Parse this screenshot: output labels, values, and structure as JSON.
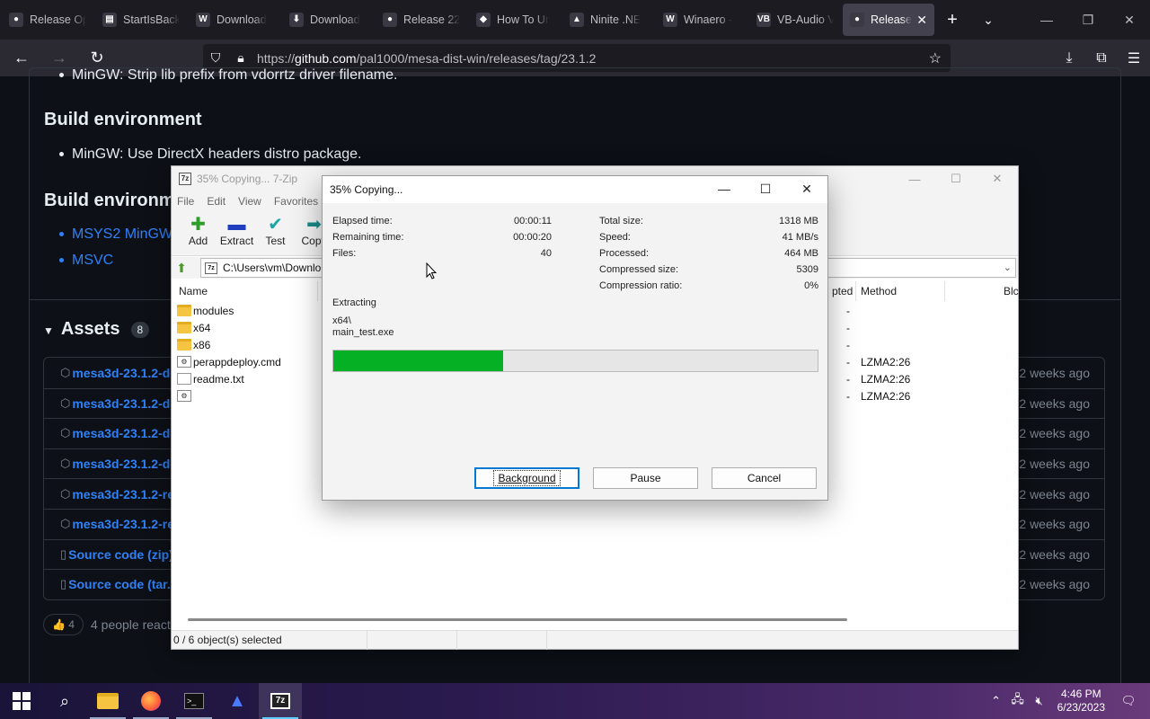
{
  "browser": {
    "tabs": [
      {
        "label": "Release Op",
        "icon": "github-icon",
        "glyph": "●"
      },
      {
        "label": "StartIsBack",
        "icon": "startisback-icon",
        "glyph": "▤"
      },
      {
        "label": "Download",
        "icon": "winaero-icon",
        "glyph": "W"
      },
      {
        "label": "Download",
        "icon": "download-site-icon",
        "glyph": "⬇"
      },
      {
        "label": "Release 22",
        "icon": "github-icon",
        "glyph": "●"
      },
      {
        "label": "How To Ur",
        "icon": "howto-icon",
        "glyph": "◆"
      },
      {
        "label": "Ninite .NE",
        "icon": "ninite-icon",
        "glyph": "▲"
      },
      {
        "label": "Winaero - ",
        "icon": "winaero-icon",
        "glyph": "W"
      },
      {
        "label": "VB-Audio V",
        "icon": "vbaudio-icon",
        "glyph": "VB"
      },
      {
        "label": "Release",
        "icon": "github-icon",
        "glyph": "●",
        "active": true
      }
    ],
    "url_prefix": "https://",
    "url_domain": "github.com",
    "url_path": "/pal1000/mesa-dist-win/releases/tag/23.1.2"
  },
  "page": {
    "partial_bullet": "MinGW: Strip lib prefix from vdorrtz driver filename.",
    "build_env_heading": "Build environment",
    "build_env_item": "MinGW: Use DirectX headers distro package.",
    "build_env2_heading": "Build environme",
    "links": [
      "MSYS2 MinGW-",
      "MSVC"
    ],
    "assets_title": "Assets",
    "assets_count": "8",
    "assets": [
      {
        "name": "mesa3d-23.1.2-de",
        "age": "2 weeks ago",
        "icon": "package-icon"
      },
      {
        "name": "mesa3d-23.1.2-de",
        "age": "2 weeks ago",
        "icon": "package-icon"
      },
      {
        "name": "mesa3d-23.1.2-de",
        "age": "2 weeks ago",
        "icon": "package-icon"
      },
      {
        "name": "mesa3d-23.1.2-de",
        "age": "2 weeks ago",
        "icon": "package-icon"
      },
      {
        "name": "mesa3d-23.1.2-re",
        "age": "2 weeks ago",
        "icon": "package-icon"
      },
      {
        "name": "mesa3d-23.1.2-re",
        "age": "2 weeks ago",
        "icon": "package-icon"
      },
      {
        "name": "Source code (zip)",
        "age": "2 weeks ago",
        "icon": "file-zip-icon"
      },
      {
        "name": "Source code (tar.",
        "age": "2 weeks ago",
        "icon": "file-zip-icon"
      }
    ],
    "reaction_emoji": "👍",
    "reaction_count": "4",
    "reaction_text": "4 people reacte"
  },
  "filemanager": {
    "title": "35% Copying... 7-Zip",
    "menu": [
      "File",
      "Edit",
      "View",
      "Favorites"
    ],
    "toolbar": [
      {
        "label": "Add",
        "glyph": "✚",
        "color": "#2a9d2a",
        "icon": "add-icon"
      },
      {
        "label": "Extract",
        "glyph": "▬",
        "color": "#1f3fbf",
        "icon": "extract-icon"
      },
      {
        "label": "Test",
        "glyph": "✔",
        "color": "#1aa6a6",
        "icon": "test-icon"
      },
      {
        "label": "Copy",
        "glyph": "➡",
        "color": "#1a8a8a",
        "icon": "copy-icon"
      }
    ],
    "path": "C:\\Users\\vm\\Downlo",
    "columns": {
      "name": "Name",
      "compressed": "pted",
      "method": "Method",
      "block": "Blc"
    },
    "rows": [
      {
        "name": "modules",
        "type": "folder",
        "compressed": "-",
        "method": ""
      },
      {
        "name": "x64",
        "type": "folder",
        "compressed": "-",
        "method": ""
      },
      {
        "name": "x86",
        "type": "folder",
        "compressed": "-",
        "method": ""
      },
      {
        "name": "perappdeploy.cmd",
        "type": "cmd",
        "compressed": "-",
        "method": "LZMA2:26"
      },
      {
        "name": "readme.txt",
        "type": "txt",
        "compressed": "-",
        "method": "LZMA2:26"
      },
      {
        "name": "",
        "type": "cmd",
        "compressed": "-",
        "method": "LZMA2:26"
      }
    ],
    "status": "0 / 6 object(s) selected"
  },
  "dialog": {
    "title": "35% Copying...",
    "elapsed_label": "Elapsed time:",
    "elapsed": "00:00:11",
    "remaining_label": "Remaining time:",
    "remaining": "00:00:20",
    "files_label": "Files:",
    "files": "40",
    "total_label": "Total size:",
    "total": "1318 MB",
    "speed_label": "Speed:",
    "speed": "41 MB/s",
    "processed_label": "Processed:",
    "processed": "464 MB",
    "compressed_label": "Compressed size:",
    "compressed": "5309",
    "ratio_label": "Compression ratio:",
    "ratio": "0%",
    "operation": "Extracting",
    "current_dir": "x64\\",
    "current_file": "main_test.exe",
    "progress_percent": 35,
    "buttons": {
      "background": "Background",
      "pause": "Pause",
      "cancel": "Cancel"
    }
  },
  "taskbar": {
    "time": "4:46 PM",
    "date": "6/23/2023",
    "items": [
      "start-button",
      "search-button",
      "file-explorer",
      "firefox",
      "terminal",
      "app-blue",
      "7zip"
    ]
  }
}
